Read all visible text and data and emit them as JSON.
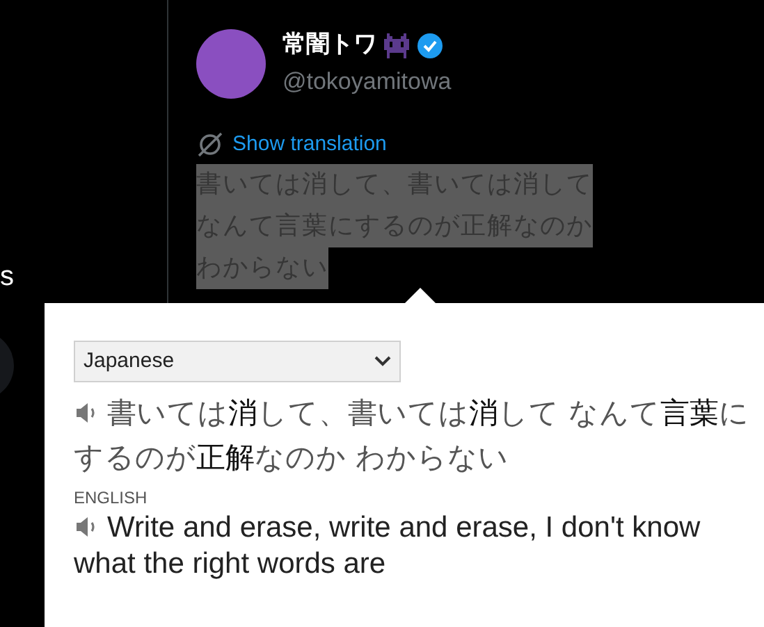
{
  "sidebar": {
    "cut_text": "s"
  },
  "tweet": {
    "display_name": "常闇トワ",
    "verified": true,
    "handle": "@tokoyamitowa",
    "translate_link": "Show translation",
    "text_lines": [
      "書いては消して、書いては消して",
      "なんて言葉にするのが正解なのか",
      "わからない"
    ],
    "text_selected": true
  },
  "popup": {
    "language_select": {
      "value": "Japanese"
    },
    "source_text": "書いては**消**して、書いては**消**して なんて**言葉**にするのが**正解**なのか わからない",
    "target_label": "ENGLISH",
    "translation": "Write and erase, write and erase, I don't know what the right words are"
  }
}
